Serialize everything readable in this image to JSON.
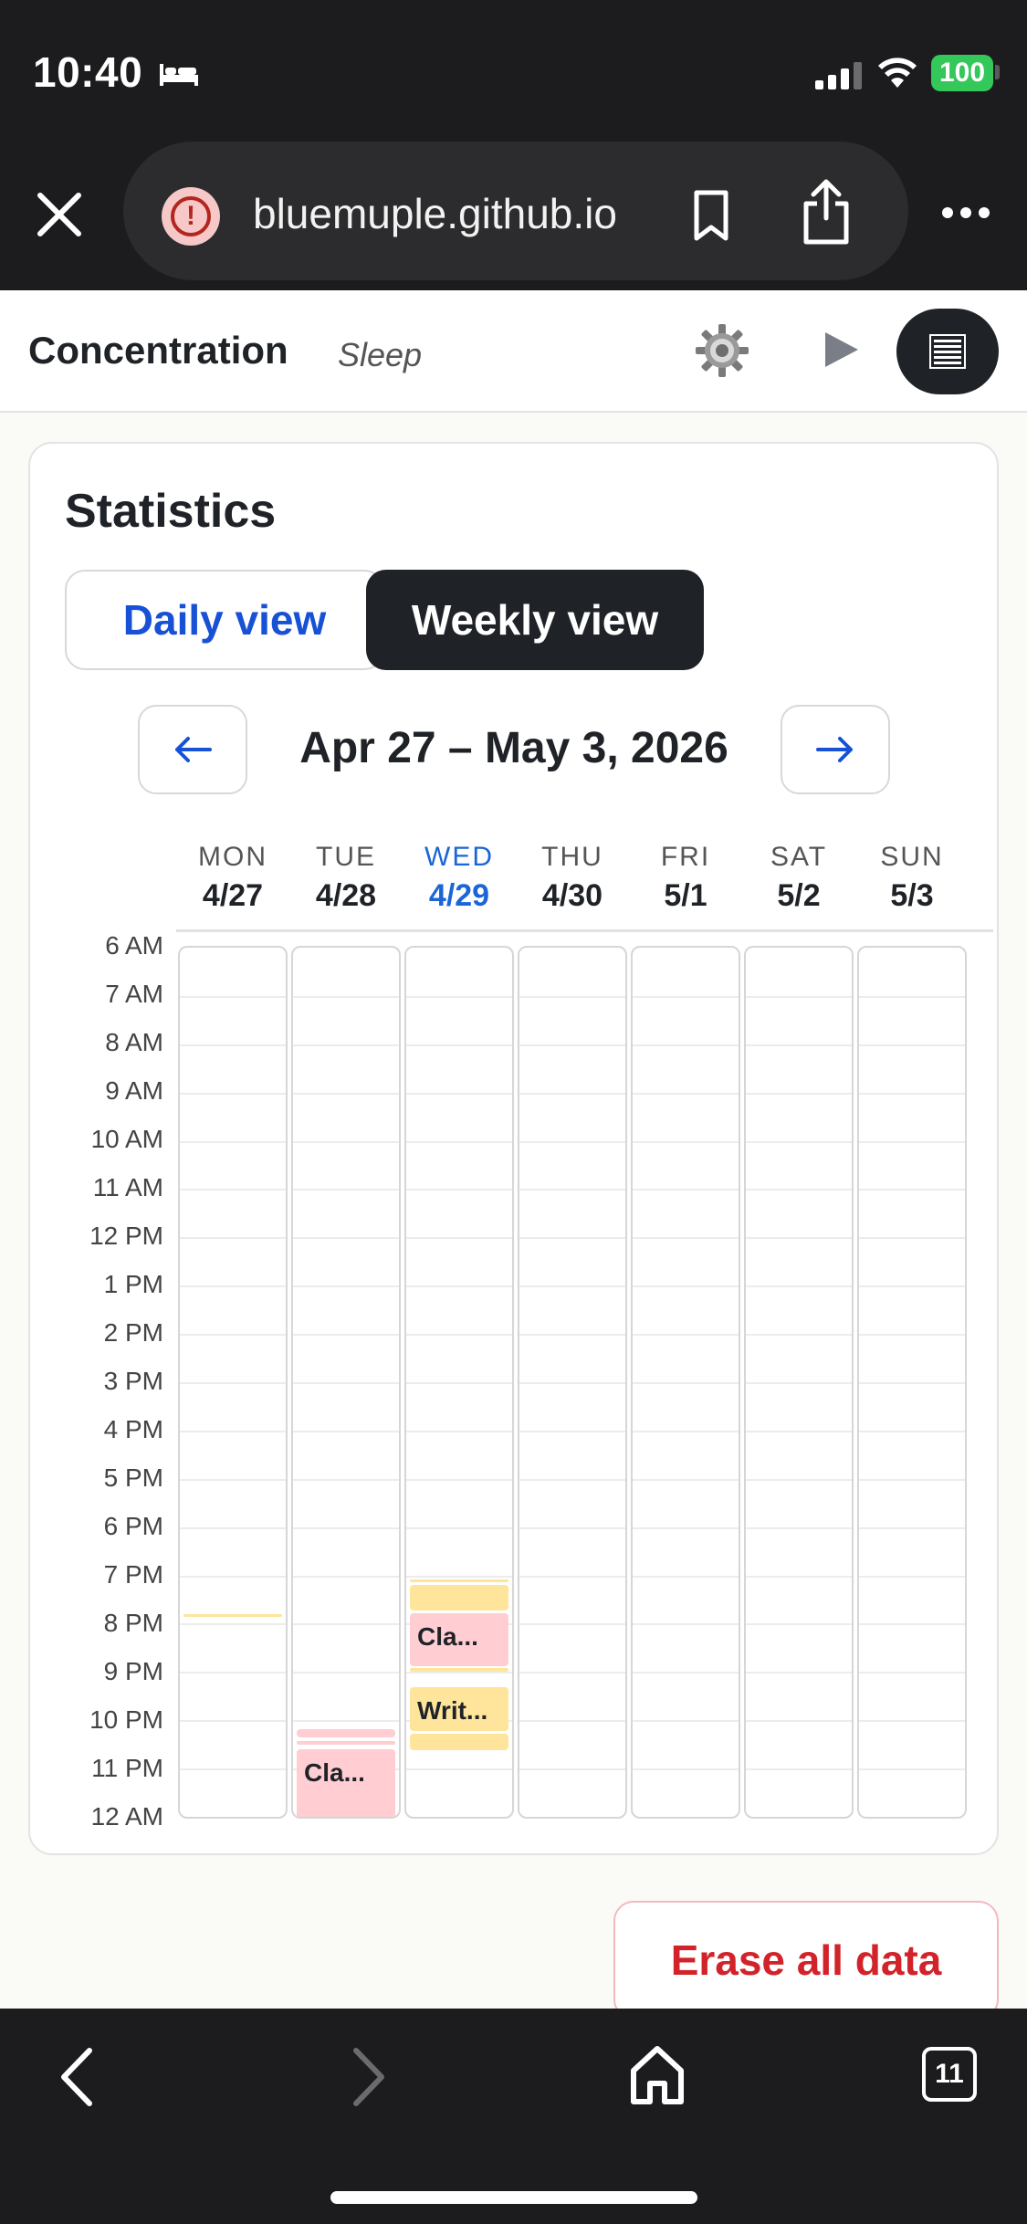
{
  "status": {
    "time": "10:40",
    "battery": "100",
    "colors": {
      "battery": "#34c759"
    }
  },
  "browser": {
    "url": "bluemuple.github.io",
    "tab_count": "11"
  },
  "header": {
    "title": "Concentration",
    "mode": "Sleep",
    "icons": [
      "gear-icon",
      "play-icon",
      "list-icon"
    ]
  },
  "stats": {
    "title": "Statistics",
    "views": {
      "daily": "Daily view",
      "weekly": "Weekly view",
      "selected": "weekly"
    },
    "range": "Apr 27 – May 3, 2026",
    "days": [
      {
        "dow": "MON",
        "date": "4/27"
      },
      {
        "dow": "TUE",
        "date": "4/28"
      },
      {
        "dow": "WED",
        "date": "4/29",
        "today": true
      },
      {
        "dow": "THU",
        "date": "4/30"
      },
      {
        "dow": "FRI",
        "date": "5/1"
      },
      {
        "dow": "SAT",
        "date": "5/2"
      },
      {
        "dow": "SUN",
        "date": "5/3"
      }
    ],
    "hours": [
      "6 AM",
      "7 AM",
      "8 AM",
      "9 AM",
      "10 AM",
      "11 AM",
      "12 PM",
      "1 PM",
      "2 PM",
      "3 PM",
      "4 PM",
      "5 PM",
      "6 PM",
      "7 PM",
      "8 PM",
      "9 PM",
      "10 PM",
      "11 PM",
      "12 AM"
    ],
    "events": [
      {
        "day": 1,
        "label": "Cla...",
        "kind": "class"
      },
      {
        "day": 2,
        "label": "Cla...",
        "kind": "class"
      },
      {
        "day": 2,
        "label": "Writ...",
        "kind": "sleep"
      }
    ],
    "colors": {
      "today": "#1a66d6",
      "sleep_block": "#ffe49b",
      "class_block": "#ffcdd2"
    }
  },
  "actions": {
    "erase": "Erase all data",
    "erase_color": "#d2232a"
  }
}
